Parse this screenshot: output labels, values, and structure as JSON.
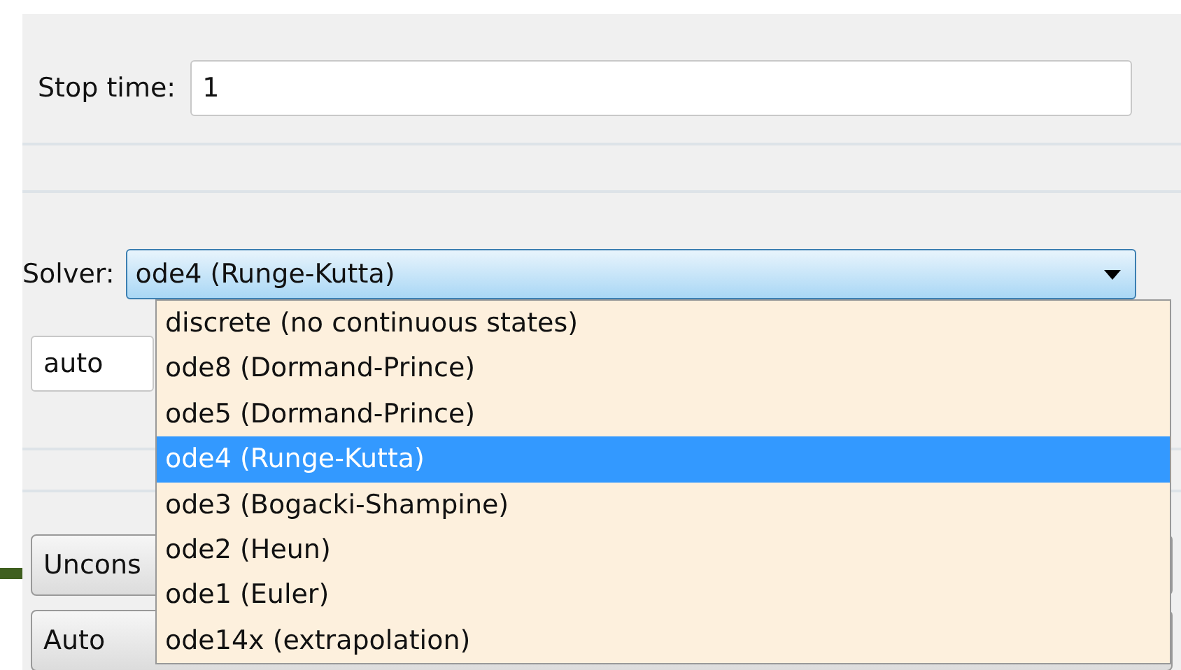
{
  "stop_time": {
    "label": "Stop time:",
    "value": "1"
  },
  "solver": {
    "label": "Solver:",
    "value": "ode4 (Runge-Kutta)",
    "expanded": true,
    "options": [
      {
        "label": "discrete (no continuous states)",
        "selected": false
      },
      {
        "label": "ode8 (Dormand-Prince)",
        "selected": false
      },
      {
        "label": "ode5 (Dormand-Prince)",
        "selected": false
      },
      {
        "label": "ode4 (Runge-Kutta)",
        "selected": true
      },
      {
        "label": "ode3 (Bogacki-Shampine)",
        "selected": false
      },
      {
        "label": "ode2 (Heun)",
        "selected": false
      },
      {
        "label": "ode1 (Euler)",
        "selected": false
      },
      {
        "label": "ode14x (extrapolation)",
        "selected": false
      }
    ]
  },
  "step_size": {
    "value": "auto"
  },
  "buttons": [
    {
      "label": "Uncons"
    },
    {
      "label": "Auto"
    }
  ]
}
